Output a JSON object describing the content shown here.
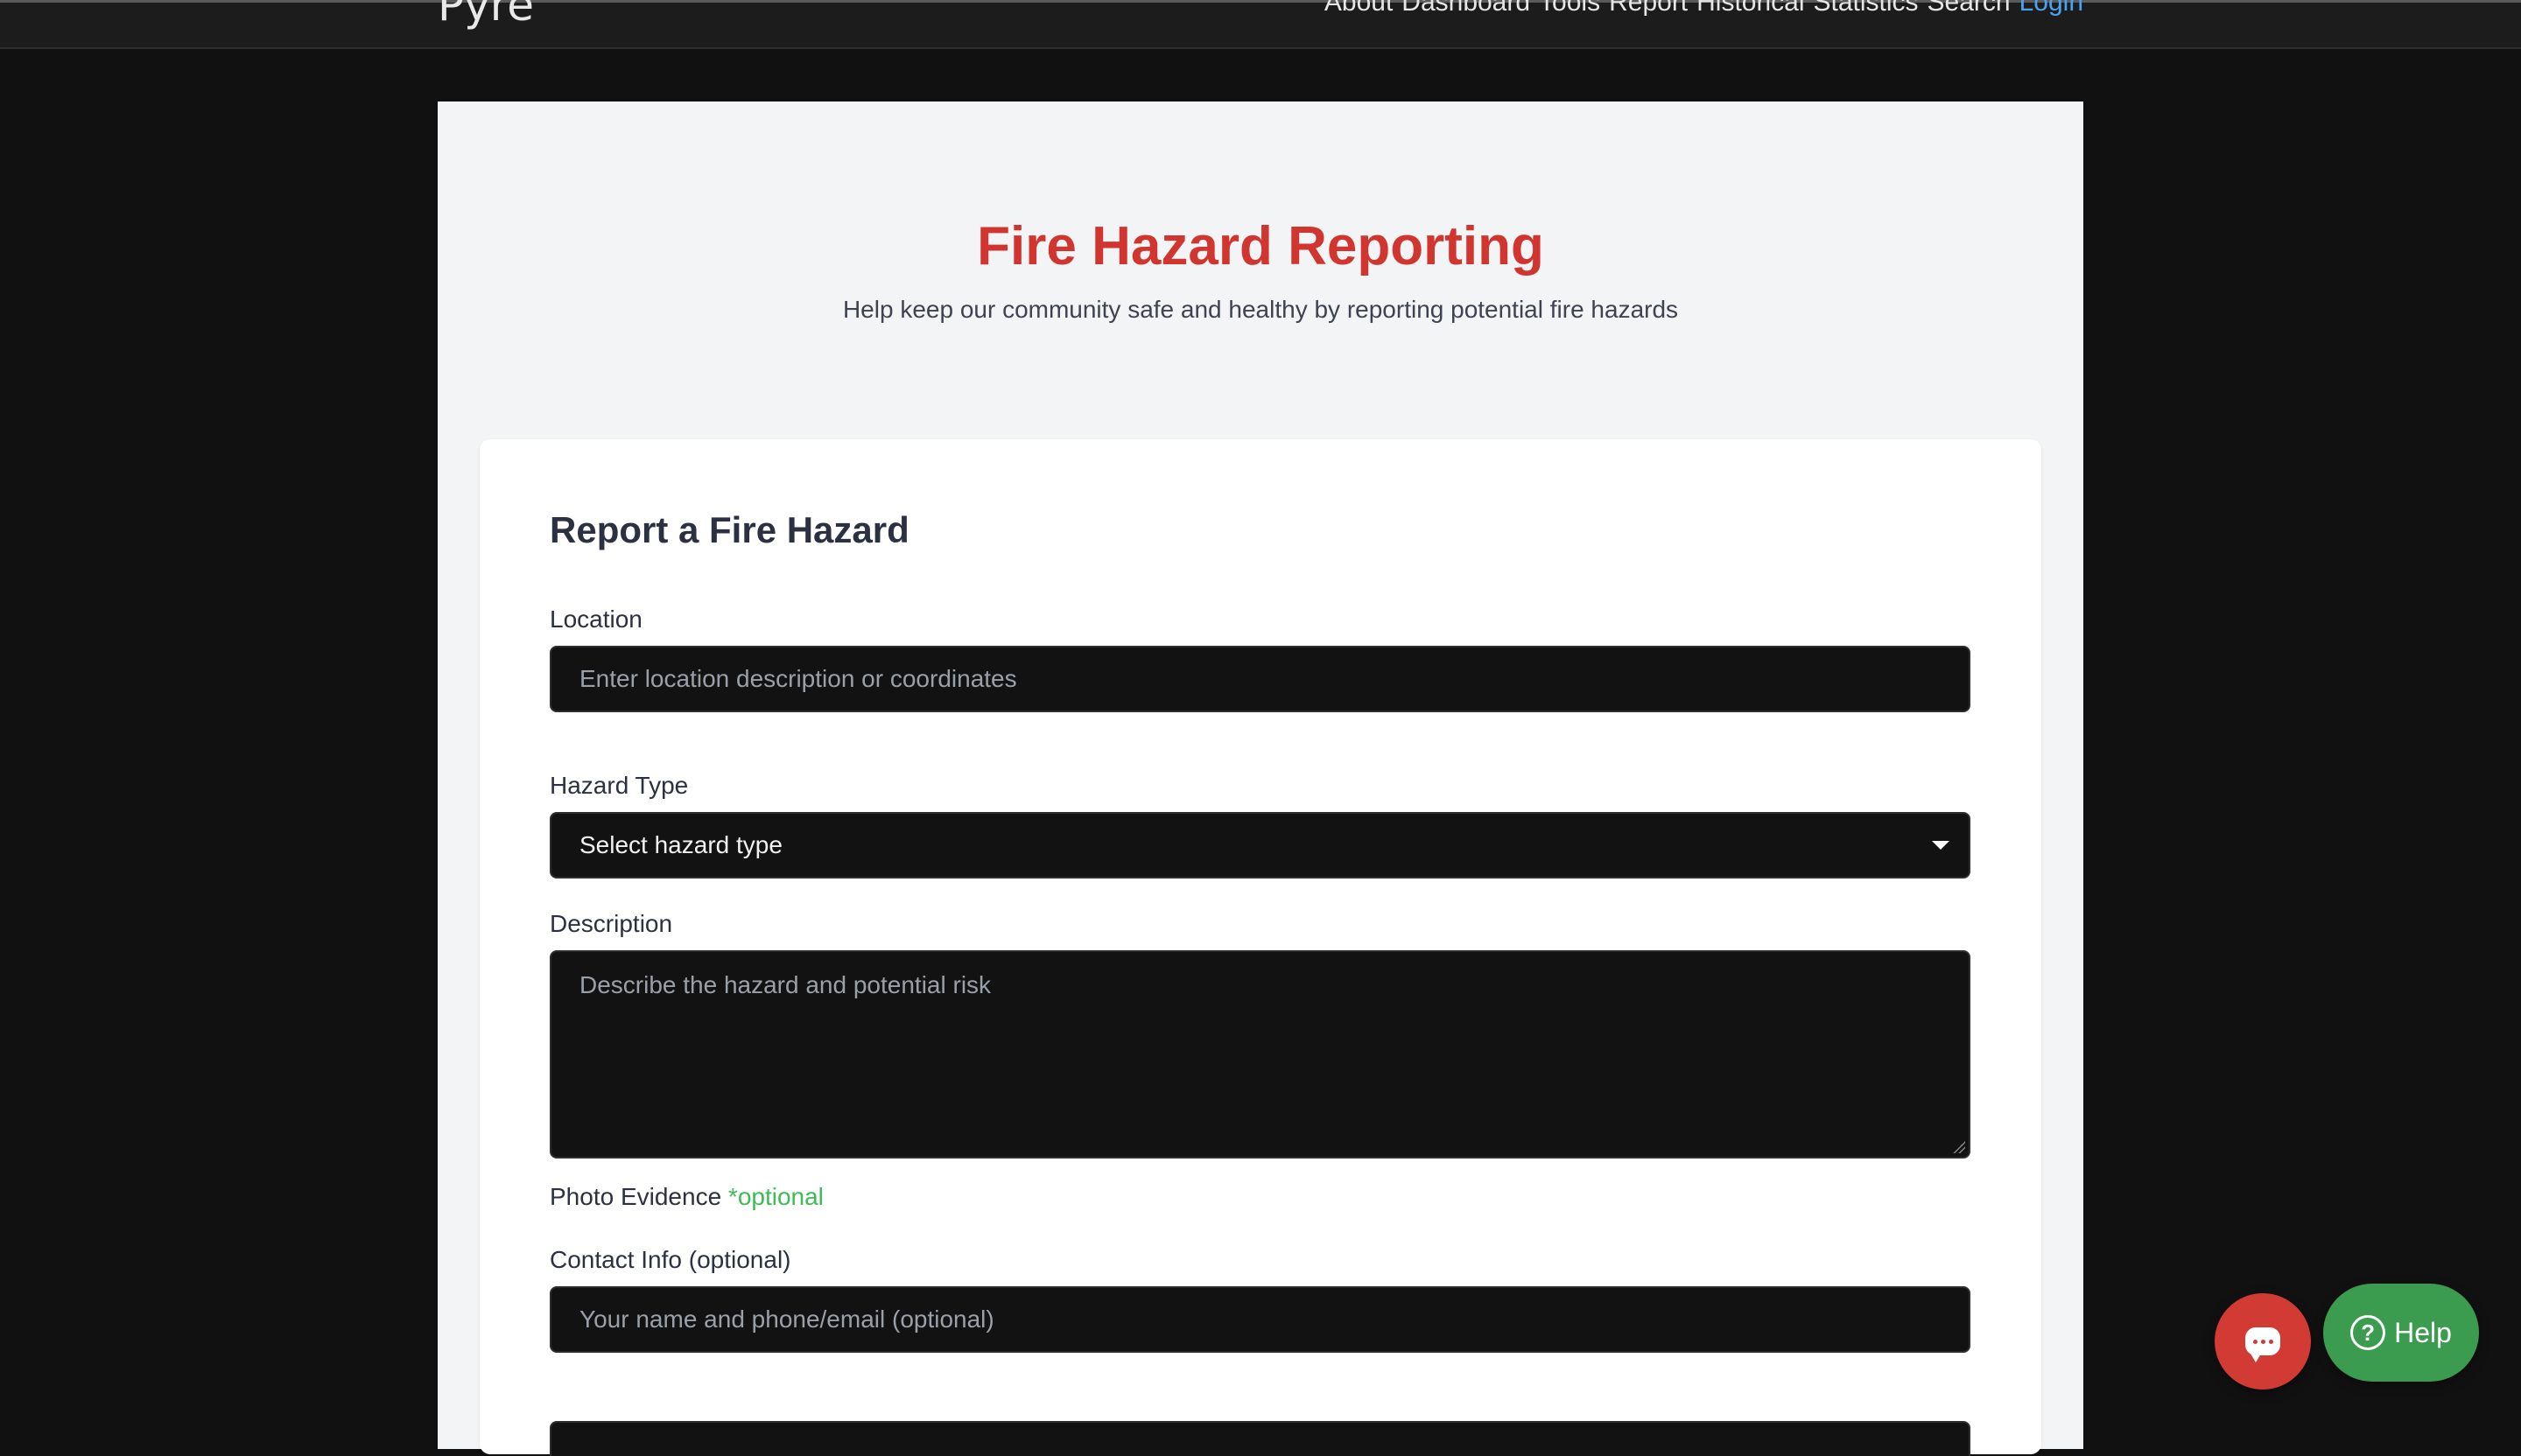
{
  "header": {
    "brand": "Pyre",
    "nav": [
      "About",
      "Dashboard",
      "Tools",
      "Report",
      "Historical",
      "Statistics",
      "Search"
    ],
    "login": "Login"
  },
  "hero": {
    "title": "Fire Hazard Reporting",
    "subtitle": "Help keep our community safe and healthy by reporting potential fire hazards"
  },
  "form": {
    "title": "Report a Fire Hazard",
    "location": {
      "label": "Location",
      "placeholder": "Enter location description or coordinates"
    },
    "hazard_type": {
      "label": "Hazard Type",
      "selected": "Select hazard type"
    },
    "description": {
      "label": "Description",
      "placeholder": "Describe the hazard and potential risk"
    },
    "photo": {
      "label": "Photo Evidence",
      "optional_tag": "*optional"
    },
    "contact": {
      "label": "Contact Info (optional)",
      "placeholder": "Your name and phone/email (optional)"
    }
  },
  "floating": {
    "help_label": "Help",
    "help_glyph": "?",
    "chat_icon": "chat-bubble-icon"
  },
  "colors": {
    "accent_red": "#d0362f",
    "help_green": "#3b9b4f",
    "optional_green": "#3dbb55",
    "link_blue": "#4aa3f0",
    "field_bg": "#121212"
  }
}
